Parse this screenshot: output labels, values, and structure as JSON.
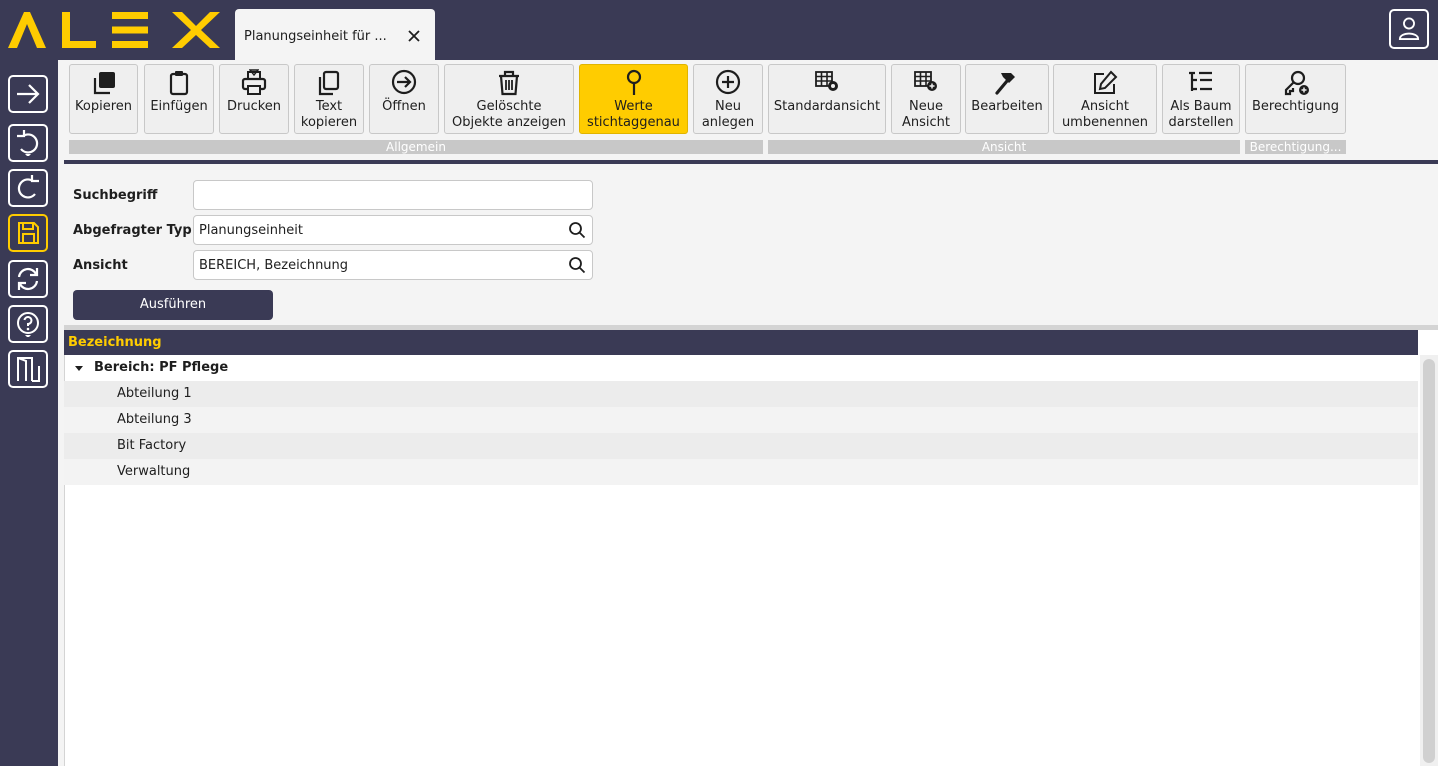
{
  "brand": {
    "logo_text": "ALEX",
    "accent": "#ffcc00",
    "dark": "#3a3a55"
  },
  "tab": {
    "title": "Planungseinheit für ...",
    "close_icon": "close-icon"
  },
  "rail": {
    "items": [
      {
        "name": "arrow-right-icon"
      },
      {
        "name": "undo-icon"
      },
      {
        "name": "redo-icon"
      },
      {
        "name": "save-icon"
      },
      {
        "name": "refresh-icon"
      },
      {
        "name": "help-icon"
      },
      {
        "name": "exit-door-icon"
      }
    ]
  },
  "ribbon": {
    "buttons": [
      {
        "id": "kopieren",
        "label": "Kopieren",
        "icon": "copy-icon"
      },
      {
        "id": "einfuegen",
        "label": "Einfügen",
        "icon": "clipboard-icon"
      },
      {
        "id": "drucken",
        "label": "Drucken",
        "icon": "printer-icon"
      },
      {
        "id": "text-kopieren",
        "label": "Text\nkopieren",
        "icon": "copy-pages-icon"
      },
      {
        "id": "oeffnen",
        "label": "Öffnen",
        "icon": "arrow-circle-icon"
      },
      {
        "id": "geloeschte",
        "label": "Gelöschte\nObjekte anzeigen",
        "icon": "trash-icon"
      },
      {
        "id": "werte",
        "label": "Werte\nstichtaggenau",
        "icon": "pin-icon"
      },
      {
        "id": "neu-anlegen",
        "label": "Neu\nanlegen",
        "icon": "plus-circle-icon"
      },
      {
        "id": "standardansicht",
        "label": "Standardansicht",
        "icon": "table-gear-icon"
      },
      {
        "id": "neue-ansicht",
        "label": "Neue\nAnsicht",
        "icon": "table-plus-icon"
      },
      {
        "id": "bearbeiten",
        "label": "Bearbeiten",
        "icon": "hammer-icon"
      },
      {
        "id": "ansicht-umbenennen",
        "label": "Ansicht\numbenennen",
        "icon": "pencil-square-icon"
      },
      {
        "id": "als-baum",
        "label": "Als Baum\ndarstellen",
        "icon": "tree-list-icon"
      },
      {
        "id": "berechtigung",
        "label": "Berechtigung",
        "icon": "key-plus-icon"
      }
    ],
    "groups": {
      "allgemein": "Allgemein",
      "ansicht": "Ansicht",
      "berechtigung": "Berechtigung..."
    }
  },
  "form": {
    "suchbegriff_label": "Suchbegriff",
    "suchbegriff_value": "",
    "typ_label": "Abgefragter Typ",
    "typ_value": "Planungseinheit",
    "ansicht_label": "Ansicht",
    "ansicht_value": "BEREICH, Bezeichnung",
    "run_label": "Ausführen"
  },
  "table": {
    "header": "Bezeichnung",
    "group": "Bereich:  PF Pflege",
    "rows": [
      "Abteilung 1",
      "Abteilung 3",
      "Bit Factory",
      "Verwaltung"
    ]
  }
}
